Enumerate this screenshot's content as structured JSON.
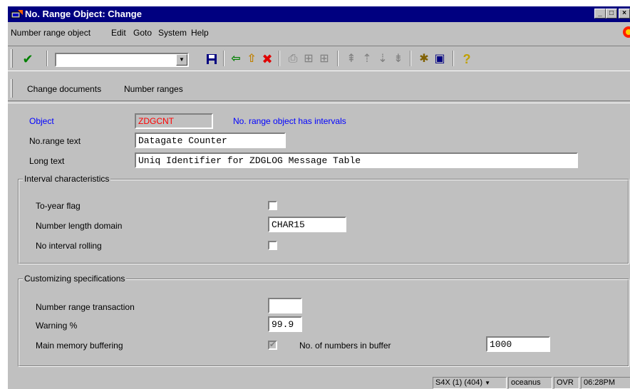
{
  "window": {
    "title": "No. Range Object: Change"
  },
  "menubar": {
    "items": [
      "Number range object",
      "Edit",
      "Goto",
      "System",
      "Help"
    ]
  },
  "toolbar": {
    "command_field_value": "",
    "icons": [
      "enter-icon",
      "save-icon",
      "back-icon",
      "exit-icon",
      "cancel-icon",
      "print-icon",
      "find-icon",
      "find-next-icon",
      "first-page-icon",
      "previous-page-icon",
      "next-page-icon",
      "last-page-icon",
      "create-session-icon",
      "shortcut-icon",
      "help-icon"
    ]
  },
  "app_toolbar": {
    "change_documents": "Change documents",
    "number_ranges": "Number ranges"
  },
  "header": {
    "object_label": "Object",
    "object_value": "ZDGCNT",
    "object_note": "No. range object has intervals",
    "range_text_label": "No.range text",
    "range_text_value": "Datagate Counter",
    "long_text_label": "Long text",
    "long_text_value": "Uniq Identifier for ZDGLOG Message Table"
  },
  "interval": {
    "title": "Interval characteristics",
    "to_year_flag_label": "To-year flag",
    "to_year_flag_checked": false,
    "number_length_domain_label": "Number length domain",
    "number_length_domain_value": "CHAR15",
    "no_interval_rolling_label": "No interval rolling",
    "no_interval_rolling_checked": false
  },
  "customizing": {
    "title": "Customizing specifications",
    "transaction_label": "Number range transaction",
    "transaction_value": "",
    "warning_label": "Warning %",
    "warning_value": "99.9",
    "buffering_label": "Main memory buffering",
    "buffering_checked": true,
    "buffer_count_label": "No. of numbers in buffer",
    "buffer_count_value": "1000"
  },
  "statusbar": {
    "system": "S4X (1) (404)",
    "server": "oceanus",
    "mode": "OVR",
    "time": "06:28PM"
  }
}
